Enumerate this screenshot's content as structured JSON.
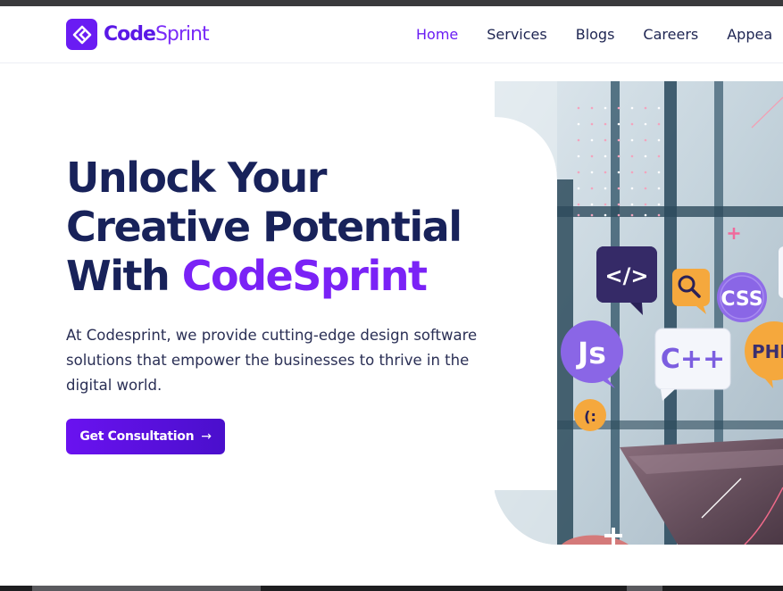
{
  "header": {
    "logo": {
      "part1": "Code",
      "part2": "Sprint"
    },
    "nav": [
      {
        "label": "Home",
        "active": true
      },
      {
        "label": "Services"
      },
      {
        "label": "Blogs"
      },
      {
        "label": "Careers"
      },
      {
        "label": "Appea"
      }
    ]
  },
  "hero": {
    "title_line1": "Unlock Your",
    "title_line2": "Creative Potential",
    "title_line3_prefix": "With ",
    "title_line3_highlight": "CodeSprint",
    "description": "At Codesprint, we provide cutting-edge design software solutions that empower the businesses to thrive in the digital world.",
    "cta_label": "Get Consultation",
    "cta_icon": "arrow-right-icon"
  },
  "visual": {
    "bubbles": [
      "</>",
      "CSS",
      "Js",
      "C++",
      "PHP",
      "(:"
    ],
    "icons": [
      "search-icon"
    ]
  },
  "colors": {
    "brand": "#6a1cf3",
    "heading": "#18225a",
    "highlight": "#7a22f6"
  }
}
